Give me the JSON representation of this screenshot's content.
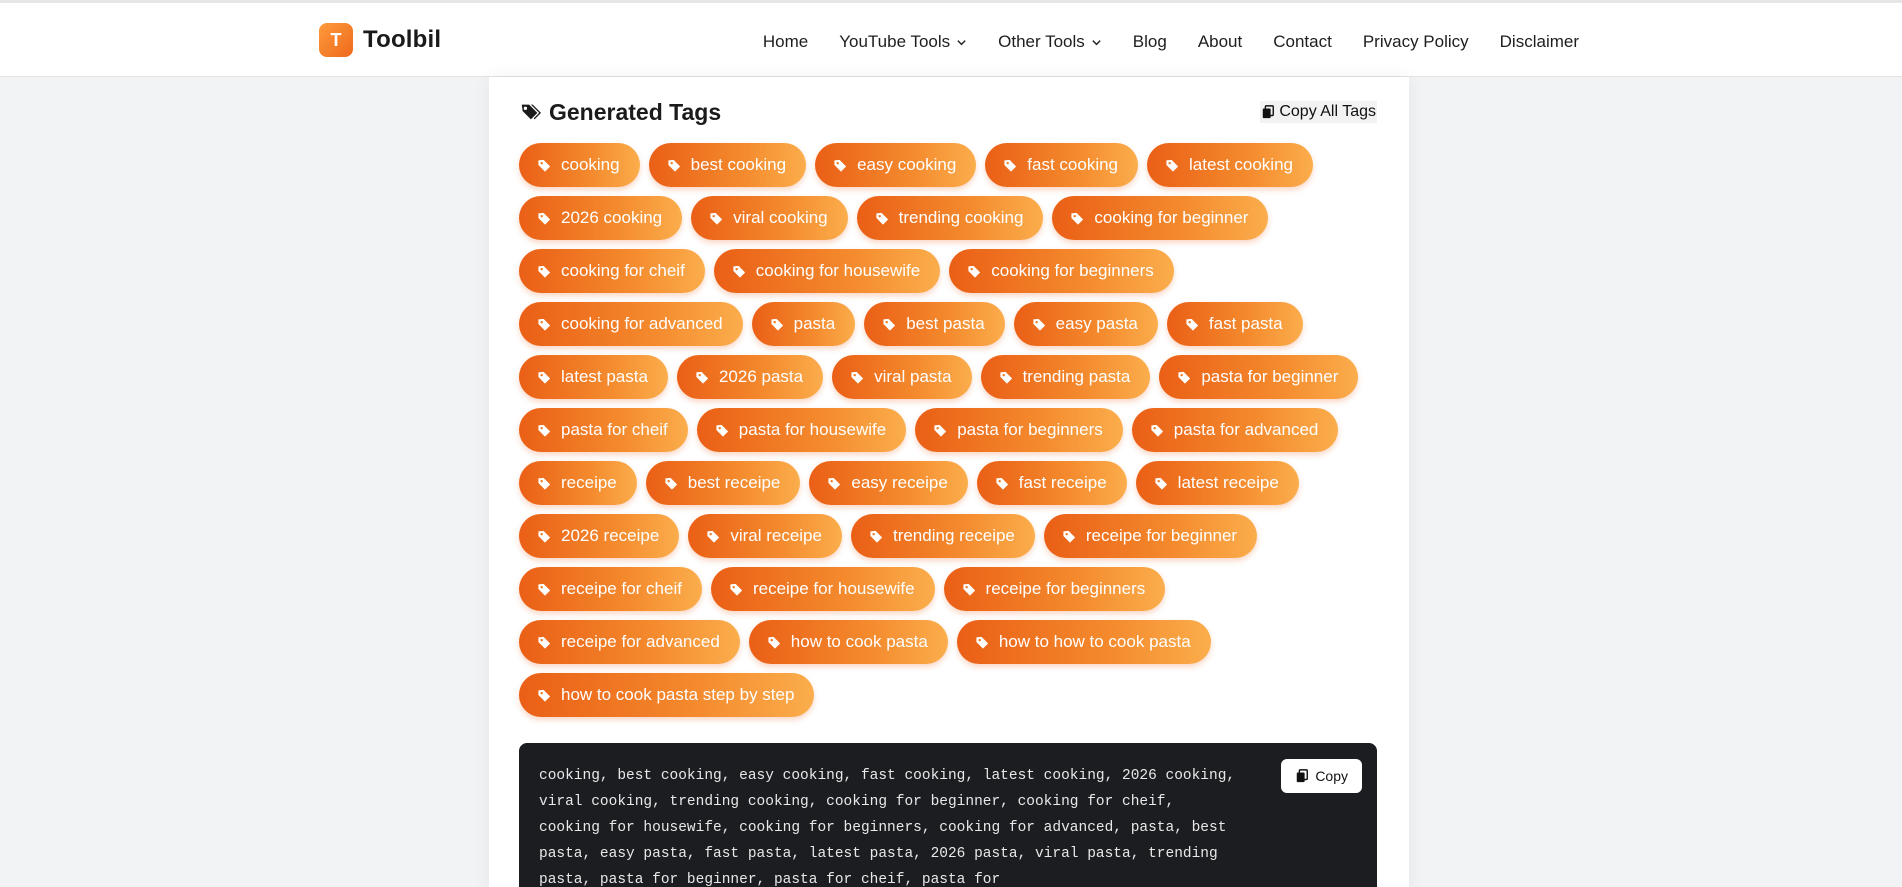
{
  "brand": {
    "logo_letter": "T",
    "name": "Toolbil",
    "accent": "#f07a22"
  },
  "nav": {
    "home": "Home",
    "youtube_tools": "YouTube Tools",
    "other_tools": "Other Tools",
    "blog": "Blog",
    "about": "About",
    "contact": "Contact",
    "privacy": "Privacy Policy",
    "disclaimer": "Disclaimer"
  },
  "panel": {
    "title": "Generated Tags",
    "copy_all": "Copy All Tags",
    "copy_button": "Copy",
    "icon": "tags-icon"
  },
  "tags": [
    "cooking",
    "best cooking",
    "easy cooking",
    "fast cooking",
    "latest cooking",
    "2026 cooking",
    "viral cooking",
    "trending cooking",
    "cooking for beginner",
    "cooking for cheif",
    "cooking for housewife",
    "cooking for beginners",
    "cooking for advanced",
    "pasta",
    "best pasta",
    "easy pasta",
    "fast pasta",
    "latest pasta",
    "2026 pasta",
    "viral pasta",
    "trending pasta",
    "pasta for beginner",
    "pasta for cheif",
    "pasta for housewife",
    "pasta for beginners",
    "pasta for advanced",
    "receipe",
    "best receipe",
    "easy receipe",
    "fast receipe",
    "latest receipe",
    "2026 receipe",
    "viral receipe",
    "trending receipe",
    "receipe for beginner",
    "receipe for cheif",
    "receipe for housewife",
    "receipe for beginners",
    "receipe for advanced",
    "how to cook pasta",
    "how to how to cook pasta",
    "how to cook pasta step by step"
  ],
  "output_text": "cooking, best cooking, easy cooking, fast cooking, latest cooking, 2026 cooking, viral cooking, trending cooking, cooking for beginner, cooking for cheif, cooking for housewife, cooking for beginners, cooking for advanced, pasta, best pasta, easy pasta, fast pasta, latest pasta, 2026 pasta, viral pasta, trending pasta, pasta for beginner, pasta for cheif, pasta for"
}
